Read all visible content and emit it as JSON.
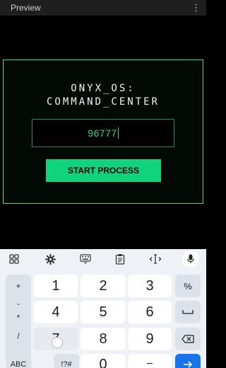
{
  "app": {
    "preview_label": "Preview"
  },
  "panel": {
    "heading_line1": "ONYX_OS:",
    "heading_line2": "COMMAND_CENTER",
    "pin_value": "96777",
    "start_label": "START PROCESS"
  },
  "colors": {
    "accent": "#2fd786",
    "button": "#11d37c",
    "background": "#000000"
  },
  "keyboard": {
    "toolbar_icons": [
      "apps-grid-icon",
      "settings-gear-icon",
      "keyboard-icon",
      "clipboard-icon",
      "text-cursor-icon",
      "mic-icon"
    ],
    "side_symbols": [
      "+",
      "-",
      "*",
      "/"
    ],
    "keys": {
      "k1": "1",
      "k2": "2",
      "k3": "3",
      "k4": "4",
      "k5": "5",
      "k6": "6",
      "k7": "7",
      "k8": "8",
      "k9": "9",
      "k0": "0",
      "percent": "%",
      "abc": "ABC",
      "sym": "!?#",
      "minus": "−"
    }
  }
}
